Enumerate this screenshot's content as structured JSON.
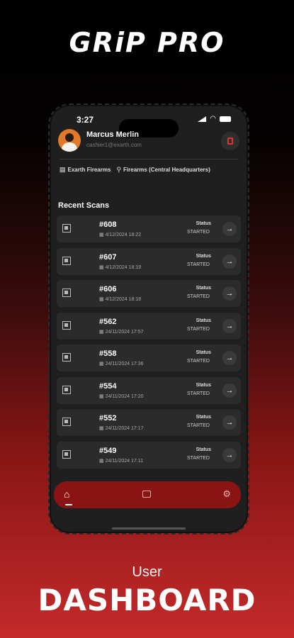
{
  "brand": {
    "title": "GRiP PRO"
  },
  "status_bar": {
    "time": "3:27"
  },
  "profile": {
    "name": "Marcus Merlin",
    "email": "cashier1@exarth.com"
  },
  "org": {
    "company": "Exarth Firearms",
    "location": "Firearms (Central Headquarters)"
  },
  "recent_scans": {
    "title": "Recent Scans",
    "status_label": "Status",
    "items": [
      {
        "id": "#608",
        "date": "4/12/2024 18:22",
        "status": "STARTED"
      },
      {
        "id": "#607",
        "date": "4/12/2024 18:19",
        "status": "STARTED"
      },
      {
        "id": "#606",
        "date": "4/12/2024 18:18",
        "status": "STARTED"
      },
      {
        "id": "#562",
        "date": "24/11/2024 17:57",
        "status": "STARTED"
      },
      {
        "id": "#558",
        "date": "24/11/2024 17:36",
        "status": "STARTED"
      },
      {
        "id": "#554",
        "date": "24/11/2024 17:20",
        "status": "STARTED"
      },
      {
        "id": "#552",
        "date": "24/11/2024 17:17",
        "status": "STARTED"
      },
      {
        "id": "#549",
        "date": "24/11/2024 17:11",
        "status": "STARTED"
      }
    ]
  },
  "footer": {
    "subtitle": "User",
    "headline": "DASHBOARD"
  },
  "colors": {
    "accent": "#8a1414",
    "panel": "#1f1f1f",
    "card": "#2b2b2b"
  },
  "icons": [
    "home-icon",
    "scan-icon",
    "settings-icon",
    "qr-icon",
    "arrow-right-icon",
    "logout-icon",
    "building-icon",
    "location-pin-icon",
    "calendar-icon"
  ]
}
